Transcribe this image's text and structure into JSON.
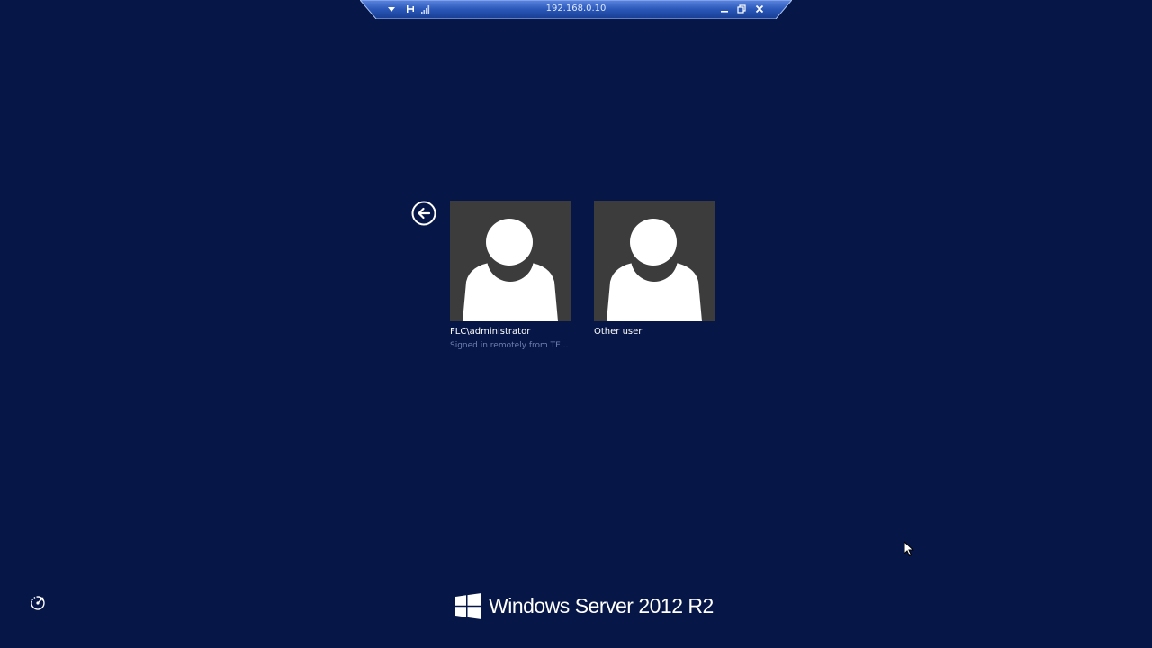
{
  "rdp_bar": {
    "host": "192.168.0.10",
    "icons": [
      "chevron-down-icon",
      "pin-icon",
      "signal-bars-icon",
      "minimize-icon",
      "restore-icon",
      "close-icon"
    ]
  },
  "login": {
    "back_icon": "back-arrow-icon",
    "users": [
      {
        "name": "FLC\\administrator",
        "status": "Signed in remotely from TE..."
      },
      {
        "name": "Other user",
        "status": ""
      }
    ]
  },
  "footer": {
    "ease_of_access_icon": "ease-of-access-icon",
    "brand_logo_icon": "windows-logo-icon",
    "brand_text": "Windows Server 2012 R2"
  },
  "colors": {
    "background": "#061646",
    "tile": "#3c3c3c",
    "status_text": "#6f7fb0",
    "rdp_bar": "#2a57b8"
  }
}
